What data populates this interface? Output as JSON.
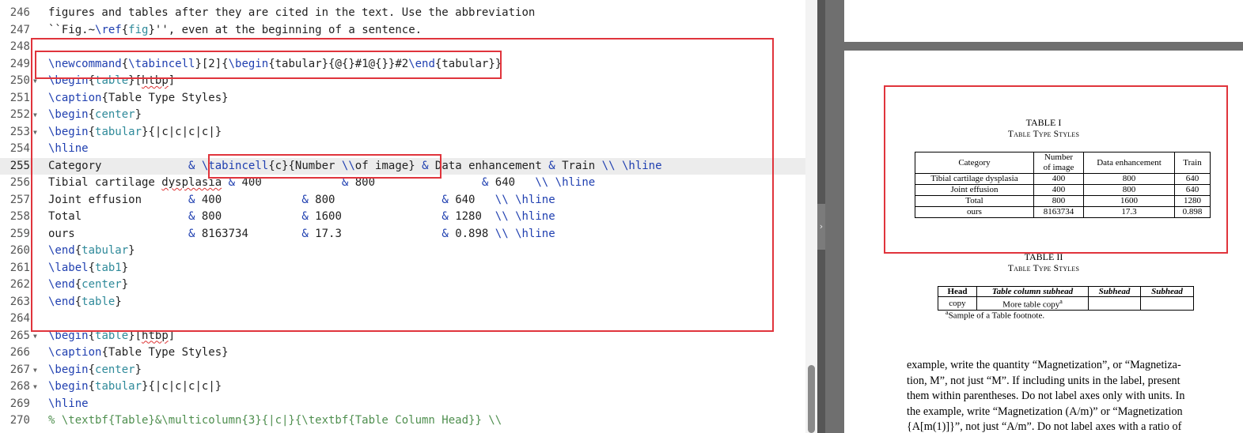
{
  "editor": {
    "lines": [
      {
        "n": "246",
        "fold": false,
        "segs": [
          {
            "t": "figures and tables after they are cited in the text. Use the abbreviation",
            "c": "blk"
          }
        ]
      },
      {
        "n": "247",
        "fold": false,
        "segs": [
          {
            "t": "``Fig.~",
            "c": "blk"
          },
          {
            "t": "\\ref",
            "c": "cmd"
          },
          {
            "t": "{",
            "c": "blk"
          },
          {
            "t": "fig",
            "c": "arg"
          },
          {
            "t": "}'', even at the beginning of a sentence.",
            "c": "blk"
          }
        ]
      },
      {
        "n": "248",
        "fold": false,
        "segs": []
      },
      {
        "n": "249",
        "fold": false,
        "segs": [
          {
            "t": "\\newcommand",
            "c": "cmd"
          },
          {
            "t": "{",
            "c": "blk"
          },
          {
            "t": "\\tabincell",
            "c": "cmd"
          },
          {
            "t": "}[2]{",
            "c": "blk"
          },
          {
            "t": "\\begin",
            "c": "cmd"
          },
          {
            "t": "{tabular}{@{}#1@{}}#2",
            "c": "blk"
          },
          {
            "t": "\\end",
            "c": "cmd"
          },
          {
            "t": "{tabular}}",
            "c": "blk"
          }
        ]
      },
      {
        "n": "250",
        "fold": true,
        "segs": [
          {
            "t": "\\begin",
            "c": "cmd"
          },
          {
            "t": "{",
            "c": "blk"
          },
          {
            "t": "table",
            "c": "arg"
          },
          {
            "t": "}[",
            "c": "blk"
          },
          {
            "t": "htbp",
            "c": "spell"
          },
          {
            "t": "]",
            "c": "blk"
          }
        ]
      },
      {
        "n": "251",
        "fold": false,
        "segs": [
          {
            "t": "\\caption",
            "c": "cmd"
          },
          {
            "t": "{Table Type Styles}",
            "c": "blk"
          }
        ]
      },
      {
        "n": "252",
        "fold": true,
        "segs": [
          {
            "t": "\\begin",
            "c": "cmd"
          },
          {
            "t": "{",
            "c": "blk"
          },
          {
            "t": "center",
            "c": "arg"
          },
          {
            "t": "}",
            "c": "blk"
          }
        ]
      },
      {
        "n": "253",
        "fold": true,
        "segs": [
          {
            "t": "\\begin",
            "c": "cmd"
          },
          {
            "t": "{",
            "c": "blk"
          },
          {
            "t": "tabular",
            "c": "arg"
          },
          {
            "t": "}{|c|c|c|c|}",
            "c": "blk"
          }
        ]
      },
      {
        "n": "254",
        "fold": false,
        "segs": [
          {
            "t": "\\hline",
            "c": "cmd"
          }
        ]
      },
      {
        "n": "255",
        "fold": false,
        "active": true,
        "segs": [
          {
            "t": "Category             ",
            "c": "blk"
          },
          {
            "t": "&",
            "c": "cmd"
          },
          {
            "t": " ",
            "c": "blk"
          },
          {
            "t": "\\tabincell",
            "c": "cmd"
          },
          {
            "t": "{c}{Number ",
            "c": "blk"
          },
          {
            "t": "\\\\",
            "c": "cmd"
          },
          {
            "t": "of image} ",
            "c": "blk"
          },
          {
            "t": "&",
            "c": "cmd"
          },
          {
            "t": " Data enhancement ",
            "c": "blk"
          },
          {
            "t": "&",
            "c": "cmd"
          },
          {
            "t": " Train ",
            "c": "blk"
          },
          {
            "t": "\\\\ \\hline",
            "c": "cmd"
          }
        ]
      },
      {
        "n": "256",
        "fold": false,
        "segs": [
          {
            "t": "Tibial cartilage ",
            "c": "blk"
          },
          {
            "t": "dysplasia",
            "c": "spell"
          },
          {
            "t": " ",
            "c": "blk"
          },
          {
            "t": "&",
            "c": "cmd"
          },
          {
            "t": " 400            ",
            "c": "blk"
          },
          {
            "t": "&",
            "c": "cmd"
          },
          {
            "t": " 800                ",
            "c": "blk"
          },
          {
            "t": "&",
            "c": "cmd"
          },
          {
            "t": " 640   ",
            "c": "blk"
          },
          {
            "t": "\\\\ \\hline",
            "c": "cmd"
          }
        ]
      },
      {
        "n": "257",
        "fold": false,
        "segs": [
          {
            "t": "Joint effusion       ",
            "c": "blk"
          },
          {
            "t": "&",
            "c": "cmd"
          },
          {
            "t": " 400            ",
            "c": "blk"
          },
          {
            "t": "&",
            "c": "cmd"
          },
          {
            "t": " 800                ",
            "c": "blk"
          },
          {
            "t": "&",
            "c": "cmd"
          },
          {
            "t": " 640   ",
            "c": "blk"
          },
          {
            "t": "\\\\ \\hline",
            "c": "cmd"
          }
        ]
      },
      {
        "n": "258",
        "fold": false,
        "segs": [
          {
            "t": "Total                ",
            "c": "blk"
          },
          {
            "t": "&",
            "c": "cmd"
          },
          {
            "t": " 800            ",
            "c": "blk"
          },
          {
            "t": "&",
            "c": "cmd"
          },
          {
            "t": " 1600               ",
            "c": "blk"
          },
          {
            "t": "&",
            "c": "cmd"
          },
          {
            "t": " 1280  ",
            "c": "blk"
          },
          {
            "t": "\\\\ \\hline",
            "c": "cmd"
          }
        ]
      },
      {
        "n": "259",
        "fold": false,
        "segs": [
          {
            "t": "ours                 ",
            "c": "blk"
          },
          {
            "t": "&",
            "c": "cmd"
          },
          {
            "t": " 8163734        ",
            "c": "blk"
          },
          {
            "t": "&",
            "c": "cmd"
          },
          {
            "t": " 17.3               ",
            "c": "blk"
          },
          {
            "t": "&",
            "c": "cmd"
          },
          {
            "t": " 0.898 ",
            "c": "blk"
          },
          {
            "t": "\\\\ \\hline",
            "c": "cmd"
          }
        ]
      },
      {
        "n": "260",
        "fold": false,
        "segs": [
          {
            "t": "\\end",
            "c": "cmd"
          },
          {
            "t": "{",
            "c": "blk"
          },
          {
            "t": "tabular",
            "c": "arg"
          },
          {
            "t": "}",
            "c": "blk"
          }
        ]
      },
      {
        "n": "261",
        "fold": false,
        "segs": [
          {
            "t": "\\label",
            "c": "cmd"
          },
          {
            "t": "{",
            "c": "blk"
          },
          {
            "t": "tab1",
            "c": "arg"
          },
          {
            "t": "}",
            "c": "blk"
          }
        ]
      },
      {
        "n": "262",
        "fold": false,
        "segs": [
          {
            "t": "\\end",
            "c": "cmd"
          },
          {
            "t": "{",
            "c": "blk"
          },
          {
            "t": "center",
            "c": "arg"
          },
          {
            "t": "}",
            "c": "blk"
          }
        ]
      },
      {
        "n": "263",
        "fold": false,
        "segs": [
          {
            "t": "\\end",
            "c": "cmd"
          },
          {
            "t": "{",
            "c": "blk"
          },
          {
            "t": "table",
            "c": "arg"
          },
          {
            "t": "}",
            "c": "blk"
          }
        ]
      },
      {
        "n": "264",
        "fold": false,
        "segs": []
      },
      {
        "n": "265",
        "fold": true,
        "segs": [
          {
            "t": "\\begin",
            "c": "cmd"
          },
          {
            "t": "{",
            "c": "blk"
          },
          {
            "t": "table",
            "c": "arg"
          },
          {
            "t": "}[",
            "c": "blk"
          },
          {
            "t": "htbp",
            "c": "spell"
          },
          {
            "t": "]",
            "c": "blk"
          }
        ]
      },
      {
        "n": "266",
        "fold": false,
        "segs": [
          {
            "t": "\\caption",
            "c": "cmd"
          },
          {
            "t": "{Table Type Styles}",
            "c": "blk"
          }
        ]
      },
      {
        "n": "267",
        "fold": true,
        "segs": [
          {
            "t": "\\begin",
            "c": "cmd"
          },
          {
            "t": "{",
            "c": "blk"
          },
          {
            "t": "center",
            "c": "arg"
          },
          {
            "t": "}",
            "c": "blk"
          }
        ]
      },
      {
        "n": "268",
        "fold": true,
        "segs": [
          {
            "t": "\\begin",
            "c": "cmd"
          },
          {
            "t": "{",
            "c": "blk"
          },
          {
            "t": "tabular",
            "c": "arg"
          },
          {
            "t": "}{|c|c|c|c|}",
            "c": "blk"
          }
        ]
      },
      {
        "n": "269",
        "fold": false,
        "segs": [
          {
            "t": "\\hline",
            "c": "cmd"
          }
        ]
      },
      {
        "n": "270",
        "fold": false,
        "segs": [
          {
            "t": "% \\textbf{Table}&\\multicolumn{3}{|c|}{\\textbf{Table Column Head}} \\\\",
            "c": "grn"
          }
        ]
      }
    ]
  },
  "preview": {
    "table1": {
      "title": "TABLE I",
      "subtitle": "Table Type Styles",
      "headers": [
        "Category",
        "Number of image",
        "Data enhancement",
        "Train"
      ],
      "header_line1": "Number",
      "header_line2": "of image",
      "rows": [
        [
          "Tibial cartilage dysplasia",
          "400",
          "800",
          "640"
        ],
        [
          "Joint effusion",
          "400",
          "800",
          "640"
        ],
        [
          "Total",
          "800",
          "1600",
          "1280"
        ],
        [
          "ours",
          "8163734",
          "17.3",
          "0.898"
        ]
      ]
    },
    "table2": {
      "title": "TABLE II",
      "subtitle": "Table Type Styles",
      "headers": [
        "Head",
        "Table column subhead",
        "Subhead",
        "Subhead"
      ],
      "row": [
        "copy",
        "More table copy",
        "",
        ""
      ],
      "sup": "a",
      "footnote_mark": "a",
      "footnote": "Sample of a Table footnote."
    },
    "body": [
      "example, write the quantity “Magnetization”, or “Magnetiza-",
      "tion, M”, not just “M”. If including units in the label, present",
      "them within parentheses. Do not label axes only with units. In",
      "the example, write “Magnetization (A/m)” or “Magnetization",
      "{A[m(1)]}”, not just “A/m”. Do not label axes with a ratio of"
    ]
  },
  "colors": {
    "highlight": "#e0343c",
    "command": "#1f3fb0",
    "argument": "#2f8a9a",
    "comment": "#4f8f4f"
  },
  "icons": {
    "fold": "fold-arrow-icon",
    "splitter": "chevron-right-icon"
  }
}
